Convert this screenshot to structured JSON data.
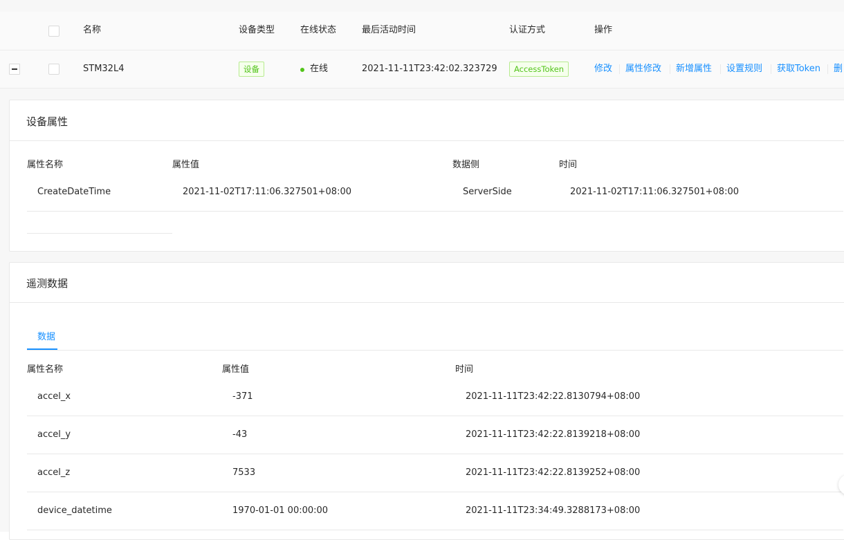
{
  "table": {
    "columns": {
      "name": "名称",
      "device_type": "设备类型",
      "online_status": "在线状态",
      "last_active": "最后活动时间",
      "auth": "认证方式",
      "actions": "操作"
    },
    "row": {
      "name": "STM32L4",
      "device_type": "设备",
      "status": "在线",
      "last_active": "2021-11-11T23:42:02.323729",
      "auth": "AccessToken",
      "actions": [
        "修改",
        "属性修改",
        "新增属性",
        "设置规则",
        "获取Token",
        "删"
      ]
    }
  },
  "attributes_card": {
    "title": "设备属性",
    "headers": {
      "name": "属性名称",
      "value": "属性值",
      "scope": "数据侧",
      "time": "时间"
    },
    "rows": [
      {
        "name": "CreateDateTime",
        "value": "2021-11-02T17:11:06.327501+08:00",
        "scope": "ServerSide",
        "time": "2021-11-02T17:11:06.327501+08:00"
      }
    ]
  },
  "telemetry_card": {
    "title": "遥测数据",
    "tabs": [
      {
        "label": "数据",
        "active": true
      }
    ],
    "headers": {
      "name": "属性名称",
      "value": "属性值",
      "time": "时间"
    },
    "rows": [
      {
        "name": "accel_x",
        "value": "-371",
        "time": "2021-11-11T23:42:22.8130794+08:00"
      },
      {
        "name": "accel_y",
        "value": "-43",
        "time": "2021-11-11T23:42:22.8139218+08:00"
      },
      {
        "name": "accel_z",
        "value": "7533",
        "time": "2021-11-11T23:42:22.8139252+08:00"
      },
      {
        "name": "device_datetime",
        "value": "1970-01-01 00:00:00",
        "time": "2021-11-11T23:34:49.3288173+08:00"
      }
    ]
  },
  "colors": {
    "link": "#1890ff",
    "success": "#52c41a",
    "border": "#e8e8e8",
    "background": "#f7f7f7"
  },
  "icons": {
    "expand": "minus-square-icon",
    "status": "status-dot-icon"
  }
}
